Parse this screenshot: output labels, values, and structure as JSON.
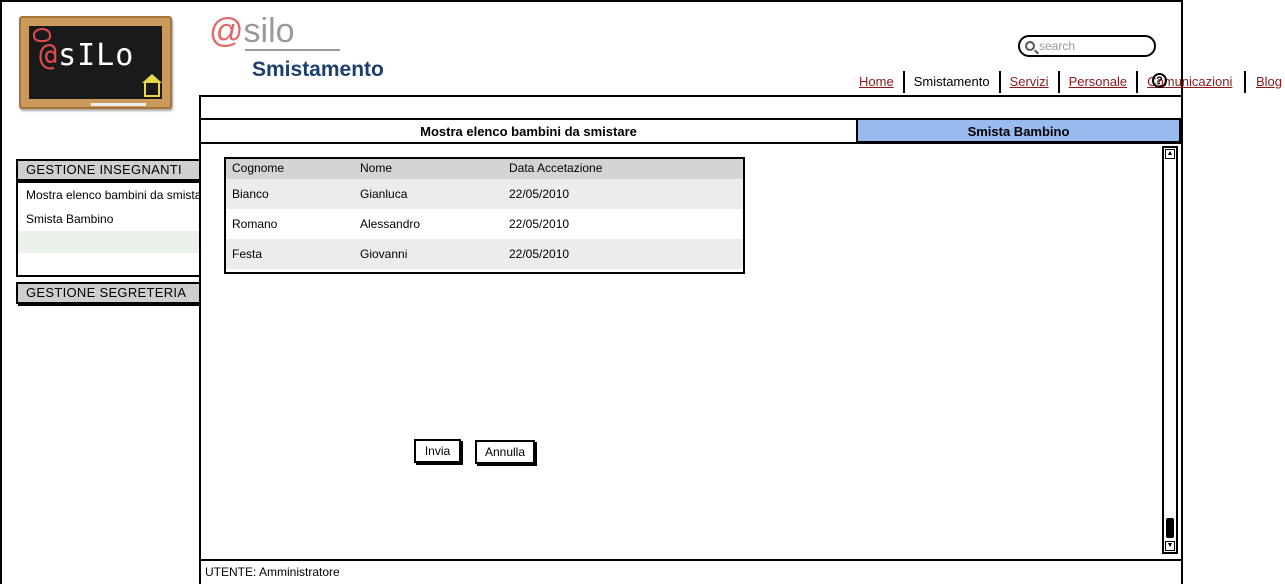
{
  "logo": {
    "icon": "chalkboard-logo",
    "text_at": "@",
    "text_rest": "sILo"
  },
  "brand": {
    "at": "@",
    "name": "silo"
  },
  "page_heading": "Smistamento",
  "search": {
    "placeholder": "search",
    "icon": "search-icon"
  },
  "nav": {
    "items": [
      {
        "label": "Home",
        "link": true
      },
      {
        "label": "Smistamento",
        "link": false
      },
      {
        "label": "Servizi",
        "link": true
      },
      {
        "label": "Personale",
        "link": true
      },
      {
        "label": "Comunicazioni",
        "link": true
      },
      {
        "label": "Blog",
        "link": true
      }
    ],
    "help_icon": "?"
  },
  "tabs": [
    {
      "label": "Mostra elenco bambini da smistare",
      "active": false
    },
    {
      "label": "Smista Bambino",
      "active": true
    }
  ],
  "table": {
    "columns": [
      "Cognome",
      "Nome",
      "Data Accetazione"
    ],
    "rows": [
      [
        "Bianco",
        "Gianluca",
        "22/05/2010"
      ],
      [
        "Romano",
        "Alessandro",
        "22/05/2010"
      ],
      [
        "Festa",
        "Giovanni",
        "22/05/2010"
      ]
    ]
  },
  "buttons": {
    "invia": "Invia",
    "annulla": "Annulla"
  },
  "sidebar": {
    "section1": "GESTIONE INSEGNANTI",
    "items": [
      "Mostra elenco bambini da smistare",
      "Smista Bambino"
    ],
    "section2": "GESTIONE SEGRETERIA"
  },
  "footer": {
    "user": "UTENTE: Amministratore"
  },
  "colors": {
    "accent_tab": "#99bbf0",
    "link": "#8b1a1a",
    "heading": "#1c3f6e"
  }
}
